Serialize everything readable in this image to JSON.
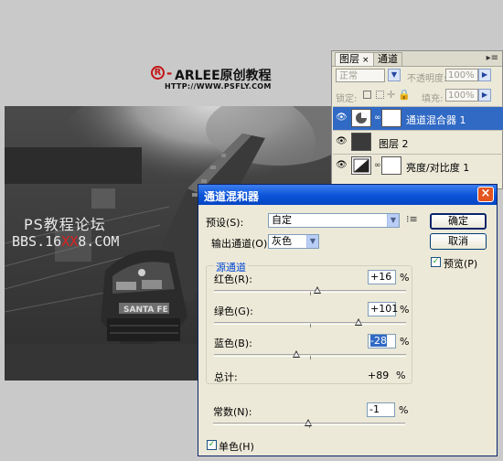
{
  "header": {
    "mark": "R",
    "dash": "-",
    "title": "ARLEE原创教程",
    "url": "HTTP://WWW.PSFLY.COM"
  },
  "watermark": {
    "line1": "PS教程论坛",
    "line2_prefix": "BBS.16",
    "line2_red": "XX",
    "line2_suffix": "8.COM"
  },
  "layers_panel": {
    "tabs": [
      {
        "label": "图层",
        "close": "×"
      },
      {
        "label": "通道"
      }
    ],
    "menu_glyph": "▸≡",
    "blend_mode": "正常",
    "opacity_label": "不透明度:",
    "opacity_value": "100%",
    "lock_label": "锁定:",
    "fill_label": "填充:",
    "fill_value": "100%",
    "layers": [
      {
        "name": "通道混合器 1",
        "selected": true
      },
      {
        "name": "图层 2",
        "selected": false
      },
      {
        "name": "亮度/对比度 1",
        "selected": false
      }
    ]
  },
  "dialog": {
    "title": "通道混和器",
    "close": "×",
    "preset_label": "预设(S):",
    "preset_value": "自定",
    "preset_menu_glyph": "⁝≡",
    "output_label": "输出通道(O):",
    "output_value": "灰色",
    "ok": "确定",
    "cancel": "取消",
    "preview_label": "预览(P)",
    "preview_checked": true,
    "source_group": "源通道",
    "red_label": "红色(R):",
    "red_value": "+16",
    "green_label": "绿色(G):",
    "green_value": "+101",
    "blue_label": "蓝色(B):",
    "blue_value": "-28",
    "pct": "%",
    "total_label": "总计:",
    "total_value": "+89",
    "constant_label": "常数(N):",
    "constant_value": "-1",
    "mono_label": "单色(H)",
    "mono_checked": true,
    "slider_levels": {
      "red": 16,
      "green": 101,
      "blue": -28,
      "constant": -1
    },
    "check_glyph": "✓"
  }
}
